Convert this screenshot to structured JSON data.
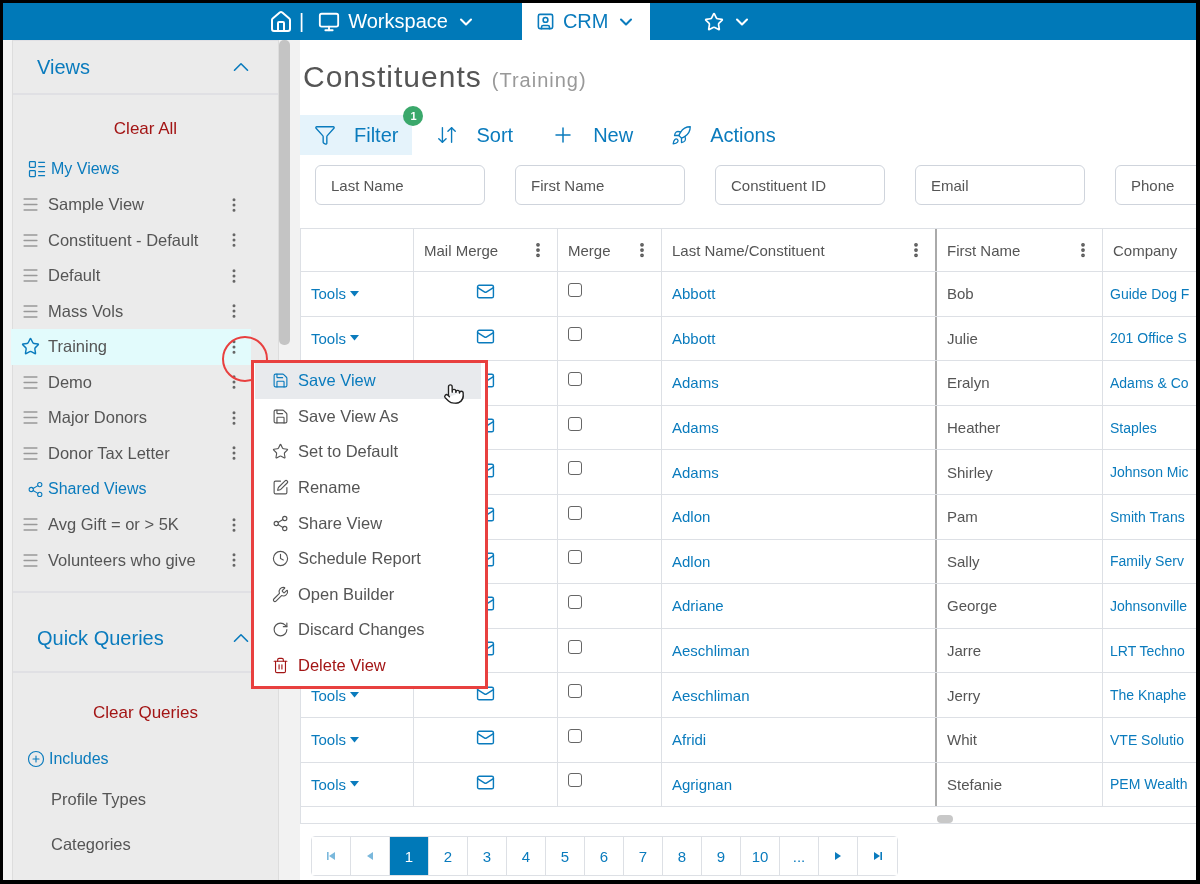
{
  "top_nav": {
    "tabs": [
      {
        "kind": "workspace",
        "label": "Workspace",
        "selected": false
      },
      {
        "kind": "crm",
        "label": "CRM",
        "selected": true
      },
      {
        "kind": "favorites",
        "selected": false
      }
    ],
    "separator": "|"
  },
  "sidebar": {
    "views": {
      "title": "Views",
      "expanded": true,
      "clear": "Clear All",
      "groups": [
        {
          "kind": "my",
          "title": "My Views",
          "items": [
            {
              "label": "Sample View",
              "selected": false
            },
            {
              "label": "Constituent - Default",
              "selected": false
            },
            {
              "label": "Default",
              "selected": false
            },
            {
              "label": "Mass Vols",
              "selected": false
            },
            {
              "label": "Training",
              "selected": true
            },
            {
              "label": "Demo",
              "selected": false
            },
            {
              "label": "Major Donors",
              "selected": false
            },
            {
              "label": "Donor Tax Letter",
              "selected": false
            }
          ]
        },
        {
          "kind": "shared",
          "title": "Shared Views",
          "items": [
            {
              "label": "Avg Gift = or > 5K",
              "selected": false
            },
            {
              "label": "Volunteers who give",
              "selected": false
            }
          ]
        }
      ]
    },
    "quick_queries": {
      "title": "Quick Queries",
      "expanded": true,
      "clear": "Clear Queries",
      "includes": "Includes",
      "options": [
        "Profile Types",
        "Categories"
      ]
    }
  },
  "page": {
    "title": "Constituents",
    "subtitle": "(Training)"
  },
  "toolbar": [
    {
      "kind": "filter",
      "label": "Filter",
      "selected": true,
      "badge": "1"
    },
    {
      "kind": "sort",
      "label": "Sort",
      "selected": false
    },
    {
      "kind": "new",
      "label": "New",
      "selected": false
    },
    {
      "kind": "actions",
      "label": "Actions",
      "selected": false
    }
  ],
  "filters": [
    {
      "placeholder": "Last Name"
    },
    {
      "placeholder": "First Name"
    },
    {
      "placeholder": "Constituent ID"
    },
    {
      "placeholder": "Email"
    },
    {
      "placeholder": "Phone"
    }
  ],
  "table": {
    "columns": [
      {},
      {
        "label": "Mail Merge"
      },
      {
        "label": "Merge"
      },
      {
        "label": "Last Name/Constituent"
      },
      {
        "label": "First Name"
      },
      {
        "label": "Company"
      }
    ],
    "rows": [
      {
        "tools": "Tools",
        "checked": false,
        "last_name": "Abbott",
        "first_name": "Bob",
        "company": "Guide Dog F"
      },
      {
        "tools": "Tools",
        "checked": false,
        "last_name": "Abbott",
        "first_name": "Julie",
        "company": "201 Office S"
      },
      {
        "checked": false,
        "last_name": "Adams",
        "first_name": "Eralyn",
        "company": "Adams & Co"
      },
      {
        "checked": false,
        "last_name": "Adams",
        "first_name": "Heather",
        "company": "Staples"
      },
      {
        "checked": false,
        "last_name": "Adams",
        "first_name": "Shirley",
        "company": "Johnson Mic"
      },
      {
        "checked": false,
        "last_name": "Adlon",
        "first_name": "Pam",
        "company": "Smith Trans"
      },
      {
        "checked": false,
        "last_name": "Adlon",
        "first_name": "Sally",
        "company": "Family Serv"
      },
      {
        "checked": false,
        "last_name": "Adriane",
        "first_name": "George",
        "company": "Johnsonville"
      },
      {
        "checked": false,
        "last_name": "Aeschliman",
        "first_name": "Jarre",
        "company": "LRT Techno"
      },
      {
        "tools": "Tools",
        "checked": false,
        "last_name": "Aeschliman",
        "first_name": "Jerry",
        "company": "The Knaphe"
      },
      {
        "tools": "Tools",
        "checked": false,
        "last_name": "Afridi",
        "first_name": "Whit",
        "company": "VTE Solutio"
      },
      {
        "tools": "Tools",
        "checked": false,
        "last_name": "Agrignan",
        "first_name": "Stefanie",
        "company": "PEM Wealth"
      }
    ]
  },
  "pagination": {
    "pages": [
      {
        "label": "1",
        "selected": true
      },
      {
        "label": "2",
        "selected": false
      },
      {
        "label": "3",
        "selected": false
      },
      {
        "label": "4",
        "selected": false
      },
      {
        "label": "5",
        "selected": false
      },
      {
        "label": "6",
        "selected": false
      },
      {
        "label": "7",
        "selected": false
      },
      {
        "label": "8",
        "selected": false
      },
      {
        "label": "9",
        "selected": false
      },
      {
        "label": "10",
        "selected": false
      },
      {
        "label": "...",
        "selected": false
      }
    ]
  },
  "context_menu": {
    "items": [
      {
        "kind": "save",
        "label": "Save View",
        "highlighted": true,
        "destructive": false
      },
      {
        "kind": "save",
        "label": "Save View As",
        "highlighted": false,
        "destructive": false
      },
      {
        "kind": "star",
        "label": "Set to Default",
        "highlighted": false,
        "destructive": false
      },
      {
        "kind": "edit",
        "label": "Rename",
        "highlighted": false,
        "destructive": false
      },
      {
        "kind": "share",
        "label": "Share View",
        "highlighted": false,
        "destructive": false
      },
      {
        "kind": "clock",
        "label": "Schedule Report",
        "highlighted": false,
        "destructive": false
      },
      {
        "kind": "tools",
        "label": "Open Builder",
        "highlighted": false,
        "destructive": false
      },
      {
        "kind": "refresh",
        "label": "Discard Changes",
        "highlighted": false,
        "destructive": false
      },
      {
        "kind": "trash",
        "label": "Delete View",
        "highlighted": false,
        "destructive": true
      }
    ]
  }
}
